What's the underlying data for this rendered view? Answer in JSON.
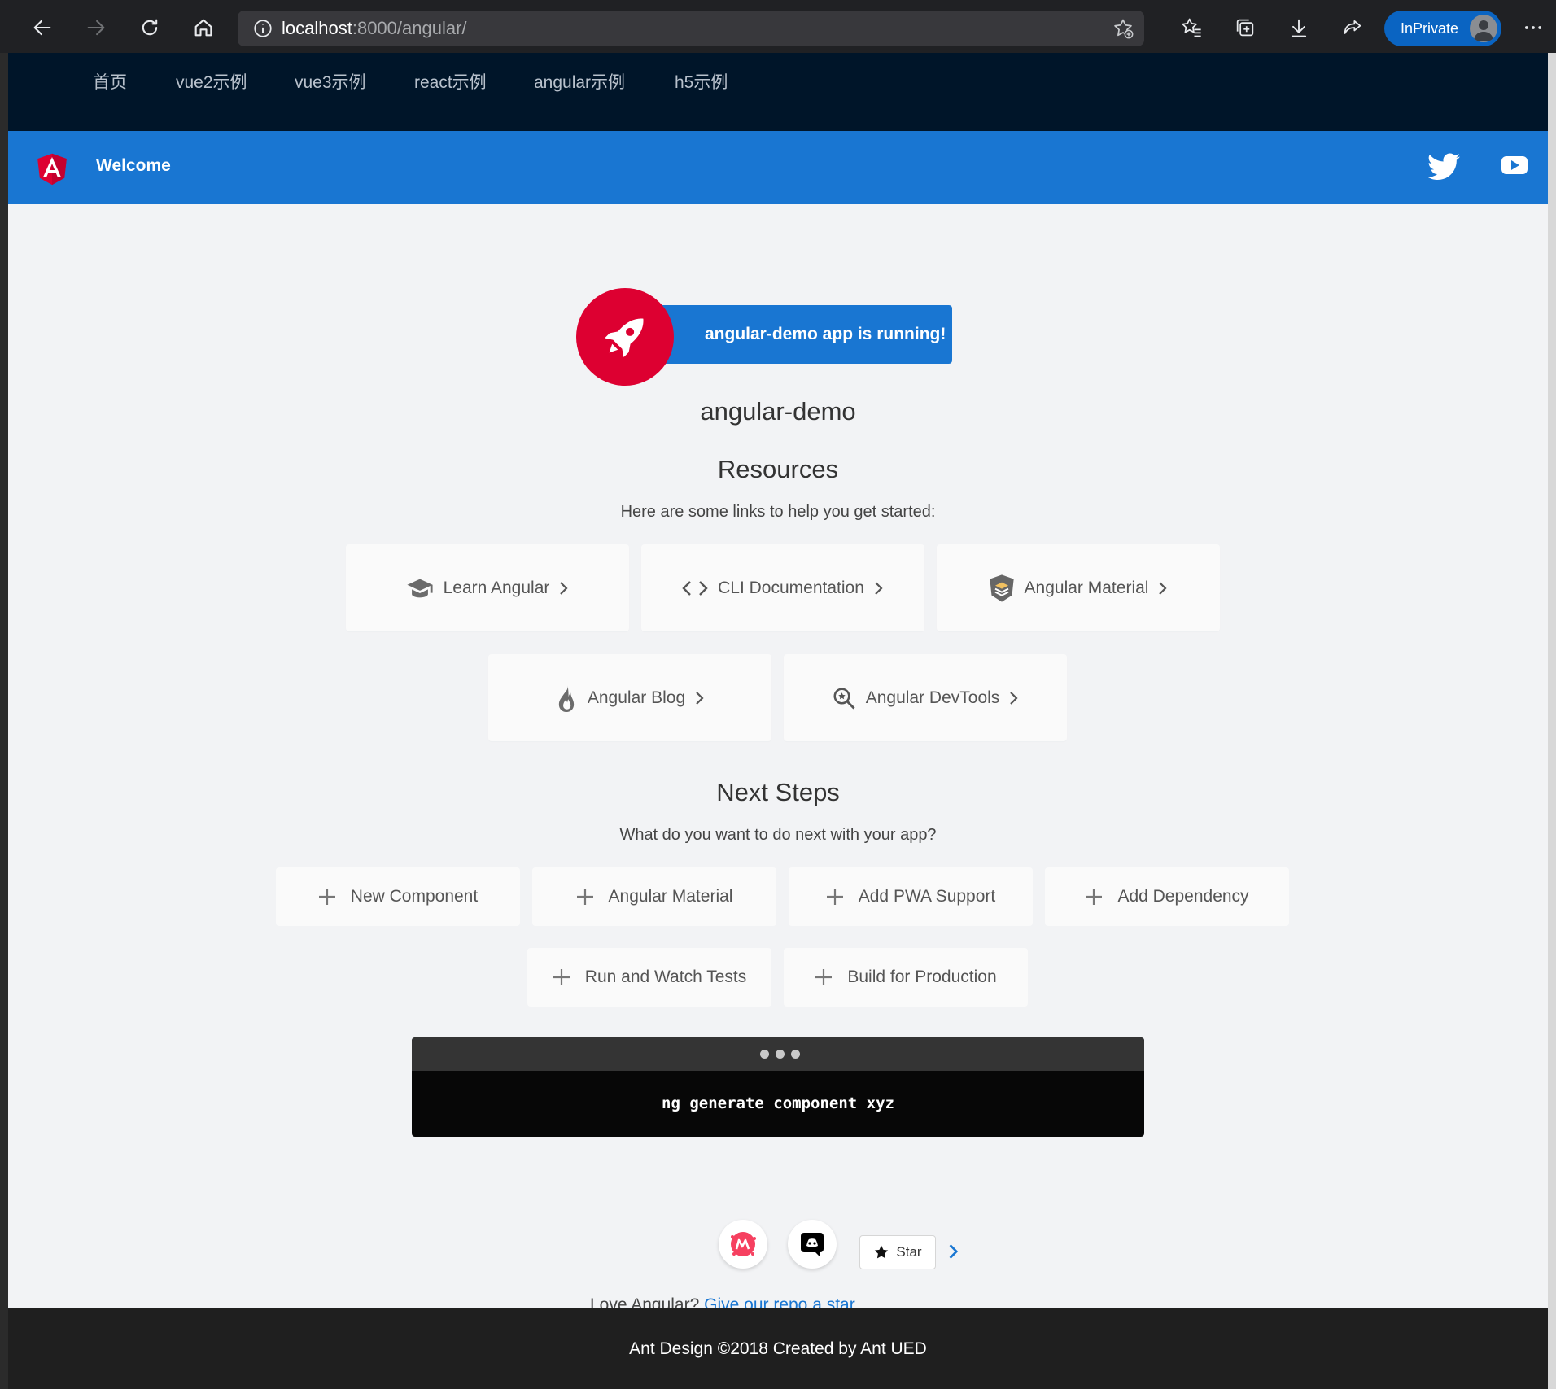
{
  "browser": {
    "url_host": "localhost",
    "url_path": ":8000/angular/",
    "inprivate_label": "InPrivate"
  },
  "top_nav": {
    "items": [
      "首页",
      "vue2示例",
      "vue3示例",
      "react示例",
      "angular示例",
      "h5示例"
    ]
  },
  "toolbar": {
    "title": "Welcome"
  },
  "main": {
    "running_text": "angular-demo app is running!",
    "app_name": "angular-demo",
    "resources_title": "Resources",
    "resources_subtitle": "Here are some links to help you get started:",
    "resources": [
      {
        "label": "Learn Angular",
        "icon": "graduation-cap-icon"
      },
      {
        "label": "CLI Documentation",
        "icon": "code-icon"
      },
      {
        "label": "Angular Material",
        "icon": "material-layers-icon"
      },
      {
        "label": "Angular Blog",
        "icon": "flame-icon"
      },
      {
        "label": "Angular DevTools",
        "icon": "magnifier-star-icon"
      }
    ],
    "next_steps_title": "Next Steps",
    "next_steps_subtitle": "What do you want to do next with your app?",
    "next_steps": [
      "New Component",
      "Angular Material",
      "Add PWA Support",
      "Add Dependency",
      "Run and Watch Tests",
      "Build for Production"
    ],
    "terminal_command": "ng generate component xyz",
    "love_text": "Love Angular?",
    "star_link_text": "Give our repo a star.",
    "star_button_label": "Star"
  },
  "footer": {
    "text": "Ant Design ©2018 Created by Ant UED"
  },
  "colors": {
    "angular_red": "#dd0031",
    "toolbar_blue": "#1976d2",
    "nav_dark": "#001529",
    "link_blue": "#1976d2"
  }
}
